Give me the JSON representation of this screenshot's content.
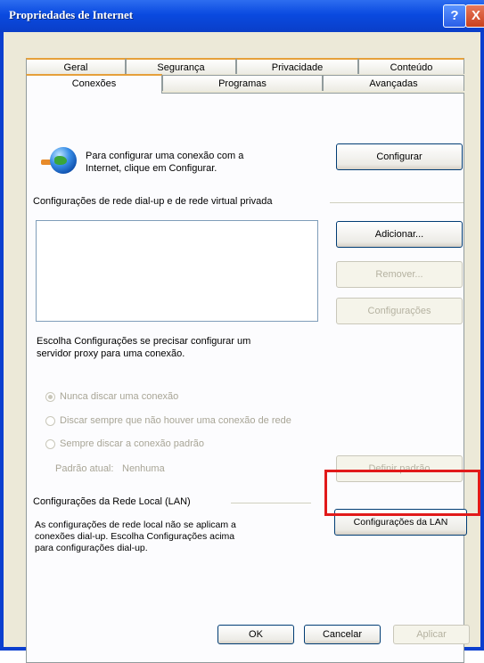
{
  "window": {
    "title": "Propriedades de Internet",
    "help_glyph": "?",
    "close_glyph": "X"
  },
  "tabs": {
    "row1": [
      "Geral",
      "Segurança",
      "Privacidade",
      "Conteúdo"
    ],
    "row2": [
      "Conexões",
      "Programas",
      "Avançadas"
    ],
    "active": "Conexões"
  },
  "setup": {
    "text_line1": "Para configurar uma conexão com a",
    "text_line2": "Internet, clique em Configurar.",
    "configure_button": "Configurar"
  },
  "dialup": {
    "group_label": "Configurações de rede dial-up e de rede virtual privada",
    "add_button": "Adicionar...",
    "remove_button": "Remover...",
    "settings_button": "Configurações",
    "proxy_line1": "Escolha Configurações se precisar configurar um",
    "proxy_line2": "servidor proxy para uma conexão.",
    "radio_never": "Nunca discar uma conexão",
    "radio_when_none": "Discar sempre que não houver uma conexão de rede",
    "radio_always": "Sempre discar a conexão padrão",
    "current_default_label": "Padrão atual:",
    "current_default_value": "Nenhuma",
    "set_default_button": "Definir padrão"
  },
  "lan": {
    "group_label": "Configurações da Rede Local (LAN)",
    "text_line1": "As configurações de rede local não se aplicam a",
    "text_line2": "conexões dial-up. Escolha Configurações acima",
    "text_line3": "para configurações dial-up.",
    "lan_button": "Configurações da LAN"
  },
  "footer": {
    "ok": "OK",
    "cancel": "Cancelar",
    "apply": "Aplicar"
  },
  "colors": {
    "highlight": "#e11a1a",
    "titlebar": "#0a4ae0"
  }
}
